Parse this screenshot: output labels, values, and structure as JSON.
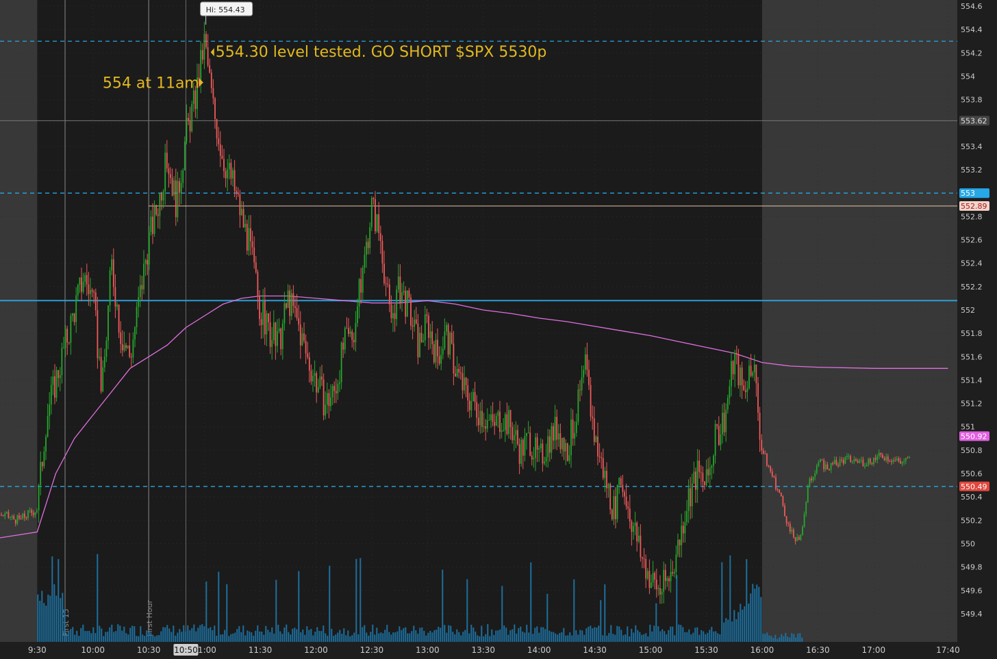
{
  "chart_data": {
    "type": "candlestick",
    "symbol_note": "",
    "yaxis": {
      "min": 549.3,
      "max": 554.6,
      "ticks": [
        "554.6",
        "554.4",
        "554.2",
        "554",
        "553.8",
        "553.62",
        "553.4",
        "553.2",
        "553",
        "552.89",
        "552.8",
        "552.6",
        "552.4",
        "552.2",
        "552",
        "551.8",
        "551.6",
        "551.4",
        "551.2",
        "551",
        "550.92",
        "550.8",
        "550.6",
        "550.49",
        "550.4",
        "550.2",
        "550",
        "549.8",
        "549.6",
        "549.4"
      ]
    },
    "xaxis": {
      "time_range": [
        "09:10",
        "17:45"
      ],
      "tick_labels": [
        "9:30",
        "10:00",
        "10:30",
        "10:50",
        "11:00",
        "11:30",
        "12:00",
        "12:30",
        "13:00",
        "13:30",
        "14:00",
        "14:30",
        "15:00",
        "15:30",
        "16:00",
        "16:30",
        "17:00",
        "17:40"
      ],
      "ticks": [
        {
          "label": "9:30",
          "t": "09:30"
        },
        {
          "label": "10:00",
          "t": "10:00"
        },
        {
          "label": "10:30",
          "t": "10:30"
        },
        {
          "label": "11:00",
          "t": "11:00"
        },
        {
          "label": "11:30",
          "t": "11:30"
        },
        {
          "label": "12:00",
          "t": "12:00"
        },
        {
          "label": "12:30",
          "t": "12:30"
        },
        {
          "label": "13:00",
          "t": "13:00"
        },
        {
          "label": "13:30",
          "t": "13:30"
        },
        {
          "label": "14:00",
          "t": "14:00"
        },
        {
          "label": "14:30",
          "t": "14:30"
        },
        {
          "label": "15:00",
          "t": "15:00"
        },
        {
          "label": "15:30",
          "t": "15:30"
        },
        {
          "label": "16:00",
          "t": "16:00"
        },
        {
          "label": "16:30",
          "t": "16:30"
        },
        {
          "label": "17:00",
          "t": "17:00"
        },
        {
          "label": "17:40",
          "t": "17:40"
        }
      ],
      "cursor_label": {
        "label": "10:50",
        "t": "10:50"
      }
    },
    "sessions": {
      "regular_start": "09:30",
      "regular_end": "16:00"
    },
    "markers": [
      {
        "label": "First 15",
        "t": "09:45"
      },
      {
        "label": "First Hour",
        "t": "10:30"
      }
    ],
    "horizontal_levels": [
      {
        "value": 554.3,
        "label": "554.3",
        "style": "dashed",
        "color": "#27a7e6"
      },
      {
        "value": 553.0,
        "label": "553",
        "style": "dashed",
        "color": "#27a7e6"
      },
      {
        "value": 550.49,
        "label": "550.49",
        "style": "dashed",
        "color": "#27a7e6",
        "tag_color": "#e0483e"
      },
      {
        "value": 552.08,
        "label": "",
        "style": "solid",
        "color": "#2a9fd8"
      },
      {
        "value": 553.62,
        "label": "553.62",
        "style": "solid-thin",
        "color": "#777777",
        "tag_color": "#444444"
      },
      {
        "value": 552.89,
        "label": "552.89",
        "style": "solid-thin",
        "color": "#e7c3a4",
        "tag_color": "#f3d2c9",
        "start_t": "10:30"
      },
      {
        "value": 550.92,
        "label": "550.92",
        "style": "none",
        "color": "#e060e0",
        "tag_color": "#e060e0"
      }
    ],
    "high_label": {
      "text": "Hi: 554.43",
      "t": "11:00",
      "value": 554.43
    },
    "annotations": [
      {
        "text": "554.30 level tested.  GO SHORT  $SPX 5530p",
        "t": "11:03",
        "value": 554.3,
        "color": "#e2b820"
      },
      {
        "text": "554 at 11am",
        "t": "10:59",
        "value": 554.0,
        "color": "#e2b820"
      }
    ],
    "price_path": [
      [
        "09:10",
        550.25
      ],
      [
        "09:20",
        550.2
      ],
      [
        "09:30",
        550.3
      ],
      [
        "09:35",
        551.1
      ],
      [
        "09:40",
        551.4
      ],
      [
        "09:45",
        551.7
      ],
      [
        "09:50",
        552.0
      ],
      [
        "09:55",
        552.3
      ],
      [
        "10:00",
        552.1
      ],
      [
        "10:05",
        551.3
      ],
      [
        "10:10",
        552.4
      ],
      [
        "10:15",
        551.8
      ],
      [
        "10:20",
        551.6
      ],
      [
        "10:25",
        552.1
      ],
      [
        "10:30",
        552.6
      ],
      [
        "10:35",
        552.9
      ],
      [
        "10:40",
        553.3
      ],
      [
        "10:45",
        552.9
      ],
      [
        "10:50",
        553.5
      ],
      [
        "10:55",
        553.8
      ],
      [
        "11:00",
        554.3
      ],
      [
        "11:05",
        553.7
      ],
      [
        "11:10",
        553.3
      ],
      [
        "11:15",
        553.1
      ],
      [
        "11:20",
        552.8
      ],
      [
        "11:25",
        552.5
      ],
      [
        "11:30",
        552.0
      ],
      [
        "11:35",
        551.8
      ],
      [
        "11:40",
        551.7
      ],
      [
        "11:45",
        552.1
      ],
      [
        "11:50",
        551.9
      ],
      [
        "11:55",
        551.6
      ],
      [
        "12:00",
        551.4
      ],
      [
        "12:05",
        551.2
      ],
      [
        "12:10",
        551.3
      ],
      [
        "12:15",
        551.7
      ],
      [
        "12:20",
        551.8
      ],
      [
        "12:25",
        552.3
      ],
      [
        "12:30",
        552.9
      ],
      [
        "12:35",
        552.6
      ],
      [
        "12:40",
        551.9
      ],
      [
        "12:45",
        552.2
      ],
      [
        "12:50",
        552.0
      ],
      [
        "12:55",
        551.7
      ],
      [
        "13:00",
        551.9
      ],
      [
        "13:05",
        551.6
      ],
      [
        "13:10",
        551.8
      ],
      [
        "13:15",
        551.5
      ],
      [
        "13:20",
        551.3
      ],
      [
        "13:25",
        551.2
      ],
      [
        "13:30",
        551.1
      ],
      [
        "13:35",
        551.0
      ],
      [
        "13:40",
        551.1
      ],
      [
        "13:45",
        551.0
      ],
      [
        "13:50",
        550.8
      ],
      [
        "13:55",
        550.9
      ],
      [
        "14:00",
        550.7
      ],
      [
        "14:05",
        550.9
      ],
      [
        "14:10",
        551.0
      ],
      [
        "14:15",
        550.8
      ],
      [
        "14:20",
        551.1
      ],
      [
        "14:25",
        551.5
      ],
      [
        "14:30",
        550.9
      ],
      [
        "14:35",
        550.6
      ],
      [
        "14:40",
        550.3
      ],
      [
        "14:45",
        550.5
      ],
      [
        "14:50",
        550.2
      ],
      [
        "14:55",
        549.9
      ],
      [
        "15:00",
        549.7
      ],
      [
        "15:05",
        549.6
      ],
      [
        "15:10",
        549.7
      ],
      [
        "15:15",
        550.0
      ],
      [
        "15:20",
        550.4
      ],
      [
        "15:25",
        550.6
      ],
      [
        "15:30",
        550.5
      ],
      [
        "15:35",
        550.9
      ],
      [
        "15:40",
        551.1
      ],
      [
        "15:45",
        551.6
      ],
      [
        "15:50",
        551.3
      ],
      [
        "15:55",
        551.6
      ],
      [
        "16:00",
        550.8
      ],
      [
        "16:05",
        550.6
      ],
      [
        "16:10",
        550.4
      ],
      [
        "16:15",
        550.1
      ],
      [
        "16:20",
        550.0
      ],
      [
        "16:25",
        550.5
      ],
      [
        "16:30",
        550.7
      ],
      [
        "16:35",
        550.65
      ],
      [
        "16:45",
        550.72
      ],
      [
        "16:55",
        550.7
      ],
      [
        "17:05",
        550.75
      ],
      [
        "17:15",
        550.7
      ],
      [
        "17:20",
        550.72
      ]
    ],
    "vwap_path": [
      [
        "09:10",
        550.05
      ],
      [
        "09:30",
        550.1
      ],
      [
        "09:40",
        550.6
      ],
      [
        "09:50",
        550.9
      ],
      [
        "10:00",
        551.1
      ],
      [
        "10:10",
        551.3
      ],
      [
        "10:20",
        551.5
      ],
      [
        "10:30",
        551.6
      ],
      [
        "10:40",
        551.7
      ],
      [
        "10:50",
        551.85
      ],
      [
        "11:00",
        551.95
      ],
      [
        "11:10",
        552.05
      ],
      [
        "11:20",
        552.1
      ],
      [
        "11:30",
        552.12
      ],
      [
        "11:45",
        552.12
      ],
      [
        "12:00",
        552.1
      ],
      [
        "12:15",
        552.08
      ],
      [
        "12:30",
        552.06
      ],
      [
        "12:45",
        552.06
      ],
      [
        "13:00",
        552.08
      ],
      [
        "13:15",
        552.05
      ],
      [
        "13:30",
        552.0
      ],
      [
        "13:45",
        551.97
      ],
      [
        "14:00",
        551.93
      ],
      [
        "14:15",
        551.9
      ],
      [
        "14:30",
        551.86
      ],
      [
        "14:45",
        551.82
      ],
      [
        "15:00",
        551.78
      ],
      [
        "15:15",
        551.73
      ],
      [
        "15:30",
        551.68
      ],
      [
        "15:45",
        551.63
      ],
      [
        "16:00",
        551.55
      ],
      [
        "16:15",
        551.52
      ],
      [
        "16:30",
        551.51
      ],
      [
        "17:00",
        551.5
      ],
      [
        "17:40",
        551.5
      ]
    ],
    "volume_note": "",
    "colors": {
      "up": "#26a82c",
      "down": "#f05a5a",
      "vwap": "#e070e0",
      "volume": "#1d6f9e",
      "background": "#1b1b1b",
      "extended_hours": "#383838",
      "axis_text": "#cccccc",
      "annotation": "#e2b820"
    }
  }
}
